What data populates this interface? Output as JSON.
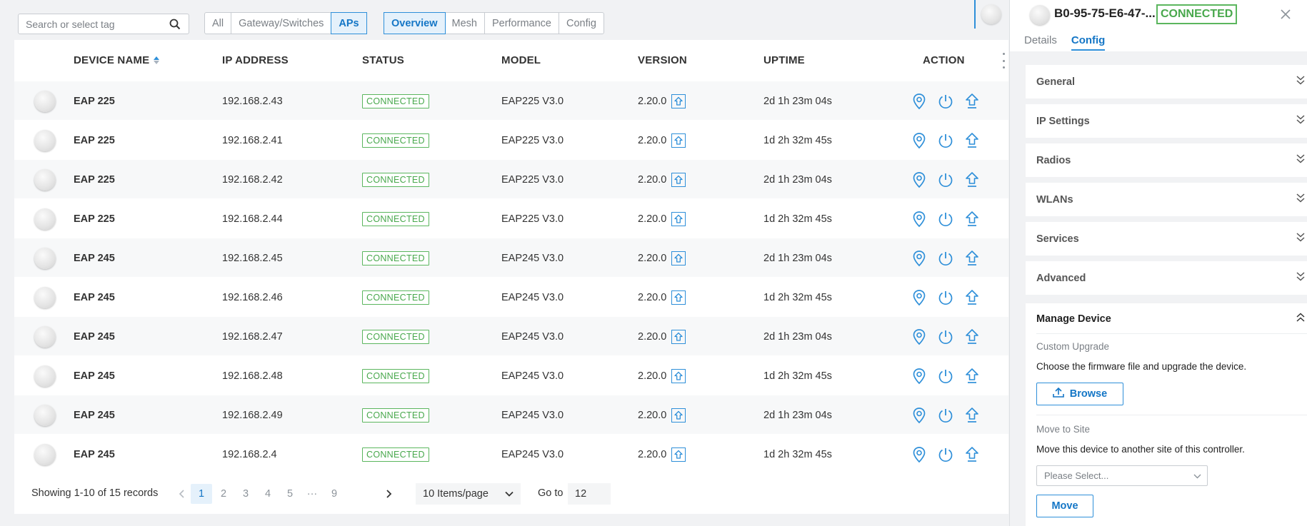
{
  "search": {
    "placeholder": "Search or select tag"
  },
  "device_filter": [
    {
      "label": "All",
      "active": false
    },
    {
      "label": "Gateway/Switches",
      "active": false
    },
    {
      "label": "APs",
      "active": true
    }
  ],
  "view_tabs": [
    {
      "label": "Overview",
      "active": true
    },
    {
      "label": "Mesh",
      "active": false
    },
    {
      "label": "Performance",
      "active": false
    },
    {
      "label": "Config",
      "active": false
    }
  ],
  "table": {
    "headers": {
      "name": "DEVICE NAME",
      "ip": "IP ADDRESS",
      "status": "STATUS",
      "model": "MODEL",
      "version": "VERSION",
      "uptime": "UPTIME",
      "action": "ACTION"
    },
    "rows": [
      {
        "name": "EAP 225",
        "ip": "192.168.2.43",
        "status": "CONNECTED",
        "model": "EAP225 V3.0",
        "version": "2.20.0",
        "uptime": "2d 1h 23m 04s"
      },
      {
        "name": "EAP 225",
        "ip": "192.168.2.41",
        "status": "CONNECTED",
        "model": "EAP225 V3.0",
        "version": "2.20.0",
        "uptime": "1d 2h 32m 45s"
      },
      {
        "name": "EAP 225",
        "ip": "192.168.2.42",
        "status": "CONNECTED",
        "model": "EAP225 V3.0",
        "version": "2.20.0",
        "uptime": "2d 1h 23m 04s"
      },
      {
        "name": "EAP 225",
        "ip": "192.168.2.44",
        "status": "CONNECTED",
        "model": "EAP225 V3.0",
        "version": "2.20.0",
        "uptime": "1d 2h 32m 45s"
      },
      {
        "name": "EAP 245",
        "ip": "192.168.2.45",
        "status": "CONNECTED",
        "model": "EAP245 V3.0",
        "version": "2.20.0",
        "uptime": "2d 1h 23m 04s"
      },
      {
        "name": "EAP 245",
        "ip": "192.168.2.46",
        "status": "CONNECTED",
        "model": "EAP245 V3.0",
        "version": "2.20.0",
        "uptime": "1d 2h 32m 45s"
      },
      {
        "name": "EAP 245",
        "ip": "192.168.2.47",
        "status": "CONNECTED",
        "model": "EAP245 V3.0",
        "version": "2.20.0",
        "uptime": "2d 1h 23m 04s"
      },
      {
        "name": "EAP 245",
        "ip": "192.168.2.48",
        "status": "CONNECTED",
        "model": "EAP245 V3.0",
        "version": "2.20.0",
        "uptime": "1d 2h 32m 45s"
      },
      {
        "name": "EAP 245",
        "ip": "192.168.2.49",
        "status": "CONNECTED",
        "model": "EAP245 V3.0",
        "version": "2.20.0",
        "uptime": "2d 1h 23m 04s"
      },
      {
        "name": "EAP 245",
        "ip": "192.168.2.4",
        "status": "CONNECTED",
        "model": "EAP245 V3.0",
        "version": "2.20.0",
        "uptime": "1d 2h 32m 45s"
      }
    ],
    "action_icons": [
      "locate-icon",
      "reboot-icon",
      "upgrade-icon"
    ]
  },
  "pagination": {
    "info": "Showing 1-10 of 15 records",
    "pages": [
      "1",
      "2",
      "3",
      "4",
      "5",
      "···",
      "9"
    ],
    "current": "1",
    "page_size": "10 Items/page",
    "goto_label": "Go to",
    "goto_value": "12"
  },
  "panel": {
    "title": "B0-95-75-E6-47-...",
    "status": "CONNECTED",
    "tabs": [
      {
        "label": "Details",
        "active": false
      },
      {
        "label": "Config",
        "active": true
      }
    ],
    "sections": [
      "General",
      "IP Settings",
      "Radios",
      "WLANs",
      "Services",
      "Advanced"
    ],
    "manage": {
      "title": "Manage Device",
      "custom_upgrade": "Custom Upgrade",
      "upgrade_desc": "Choose the firmware file and upgrade the device.",
      "browse": "Browse",
      "move_to_site": "Move to Site",
      "move_desc": "Move this device to another site of this controller.",
      "select_placeholder": "Please Select...",
      "move": "Move"
    }
  },
  "colors": {
    "accent": "#2e8fd9",
    "connected": "#48a84c"
  }
}
